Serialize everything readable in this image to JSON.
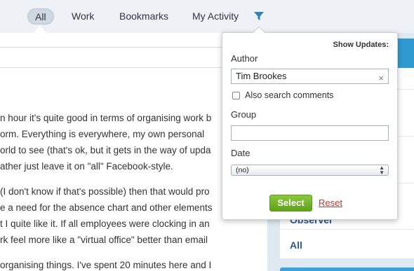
{
  "tabs": [
    {
      "label": "All",
      "active": true
    },
    {
      "label": "Work"
    },
    {
      "label": "Bookmarks"
    },
    {
      "label": "My Activity"
    }
  ],
  "filter_icon": "funnel-icon",
  "post": {
    "lines": [
      "n hour it's quite good in terms of organising work b",
      "orm. Everything is everywhere, my own personal",
      "orld to see (that's ok, but it gets in the way of upda",
      "ather just leave it on \"all\" Facebook-style.",
      "(I don't know if that's possible) then that would pro",
      "e a need for the absence chart and other elements",
      "t I quite like it. If all employees were clocking in an",
      "rk feel more like a \"virtual office\" better than email",
      "organising things. I've spent 20 minutes here and I"
    ]
  },
  "sidebar": {
    "items": [
      {
        "label": "Observer"
      },
      {
        "label": "All"
      }
    ]
  },
  "popup": {
    "title": "Show Updates:",
    "author_label": "Author",
    "author_value": "Tim Brookes",
    "clear_symbol": "×",
    "also_search_label": "Also search comments",
    "group_label": "Group",
    "group_value": "",
    "date_label": "Date",
    "date_value": "(no)",
    "select_label": "Select",
    "reset_label": "Reset"
  },
  "colors": {
    "accent_blue": "#2f9ad2",
    "select_green": "#6cb02a",
    "reset_red": "#c0392b"
  }
}
